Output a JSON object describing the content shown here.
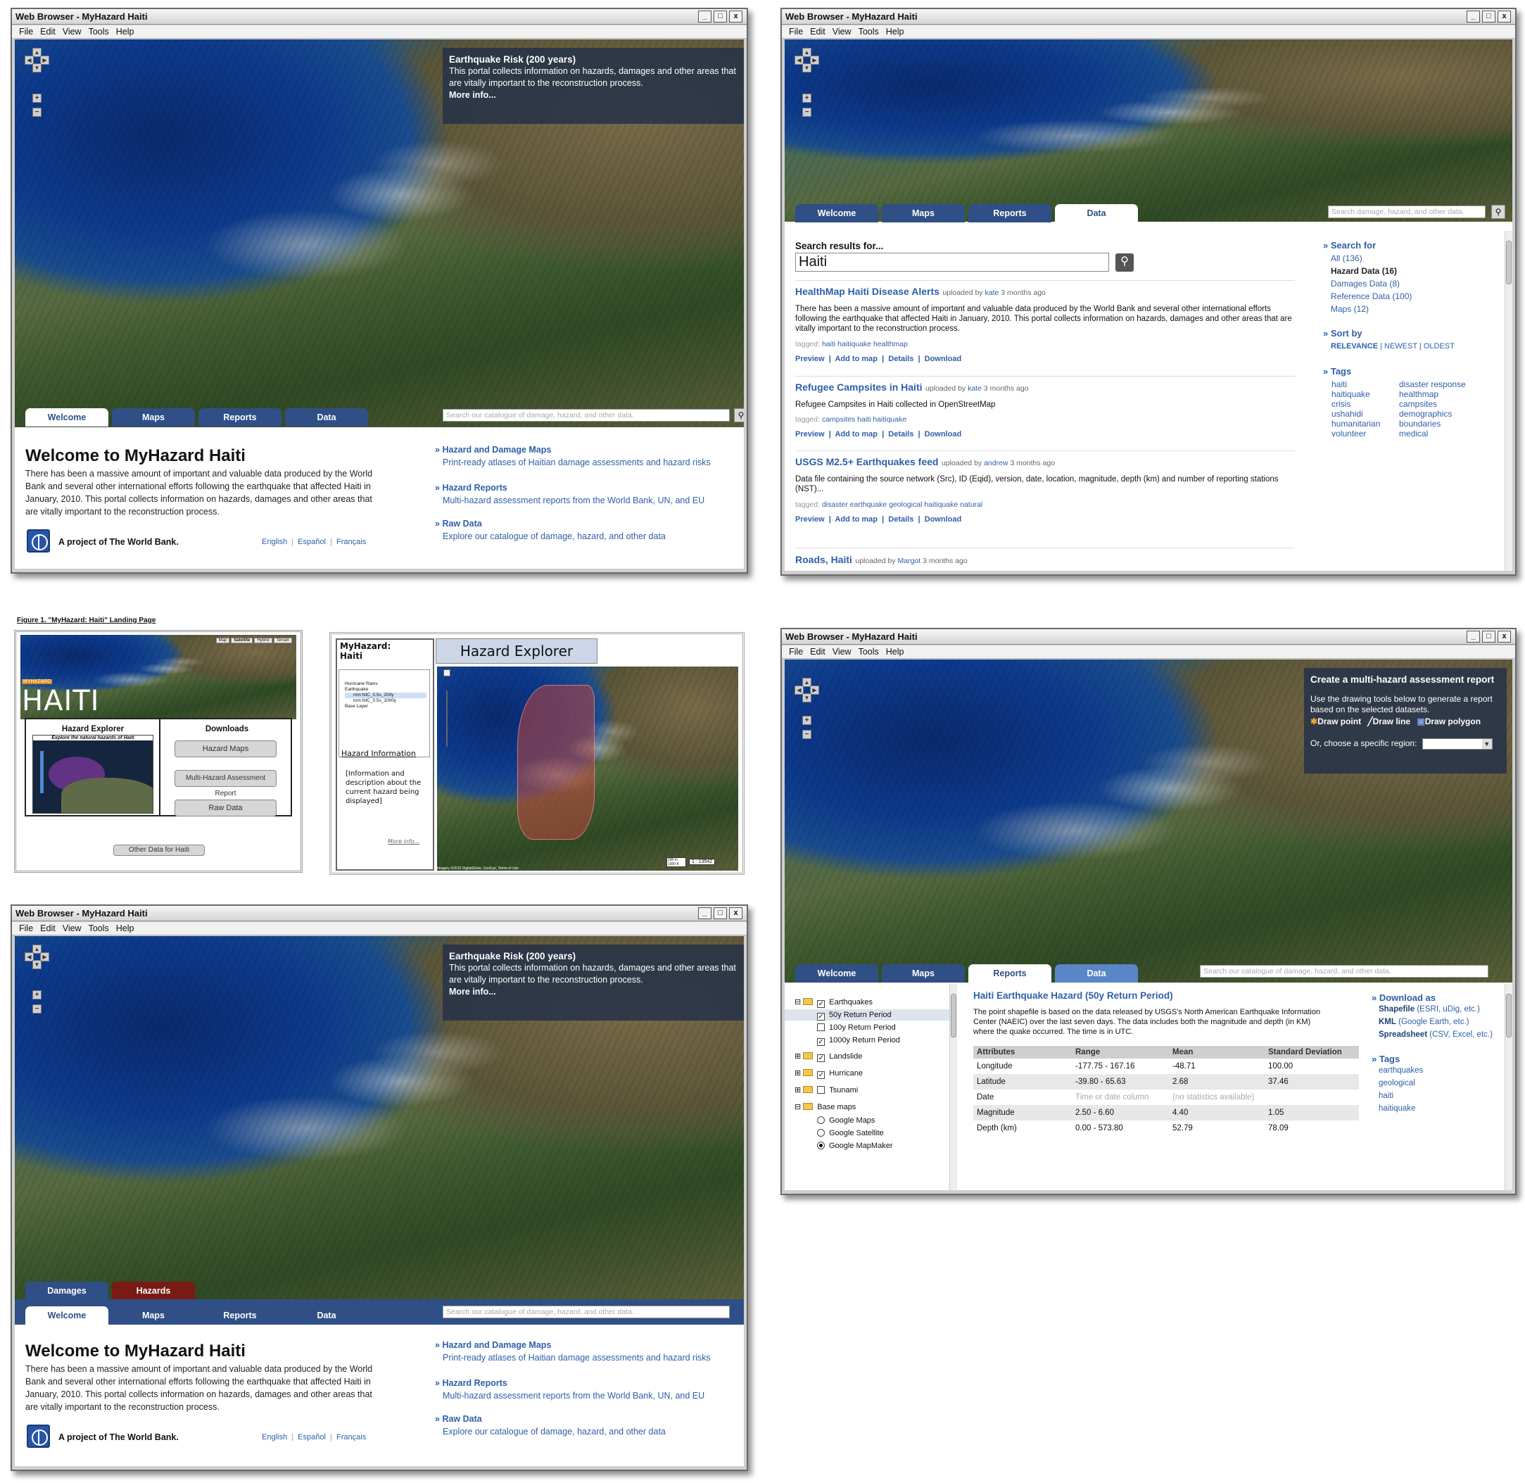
{
  "window": {
    "title": "Web Browser - MyHazard Haiti",
    "menu": [
      "File",
      "Edit",
      "View",
      "Tools",
      "Help"
    ],
    "buttons": {
      "minimize": "_",
      "maximize": "□",
      "close": "x"
    }
  },
  "tabs": {
    "welcome": "Welcome",
    "maps": "Maps",
    "reports": "Reports",
    "data": "Data"
  },
  "search_placeholder": "Search our catalogue of damage, hazard, and other data.",
  "search_placeholder_short": "Search damage, hazard, and other data.",
  "info_panel": {
    "title": "Earthquake Risk (200 years)",
    "body": "This portal collects information on hazards, damages and other areas that are vitally important to the reconstruction process.",
    "more": "More info..."
  },
  "welcome": {
    "heading": "Welcome to MyHazard Haiti",
    "body": "There has been a massive amount of important and valuable data produced by the World Bank and several other international efforts following the earthquake that affected Haiti in January, 2010. This portal collects information on hazards, damages and other areas that are vitally important to the reconstruction process.",
    "project": "A project of The World Bank.",
    "languages": [
      "English",
      "Español",
      "Français"
    ],
    "links": [
      {
        "title": "Hazard and Damage Maps",
        "desc": "Print-ready atlases of Haitian damage assessments and hazard risks"
      },
      {
        "title": "Hazard Reports",
        "desc": "Multi-hazard assessment reports from the World Bank, UN, and EU"
      },
      {
        "title": "Raw Data",
        "desc": "Explore our catalogue of damage, hazard, and other data"
      }
    ]
  },
  "layer_tabs": {
    "damages": "Damages",
    "hazards": "Hazards"
  },
  "data_page": {
    "search_label": "Search results for...",
    "query": "Haiti",
    "results": [
      {
        "title": "HealthMap Haiti Disease Alerts",
        "uploaded": "uploaded by",
        "user": "kate",
        "when": "3 months ago",
        "desc": "There has been a massive amount of important and valuable data produced by the World Bank and several other international efforts following the earthquake that affected Haiti in January, 2010. This portal collects information on hazards, damages and other areas that are vitally important to the reconstruction process.",
        "tagged": "tagged:",
        "tags": "haiti haitiquake healthmap"
      },
      {
        "title": "Refugee Campsites in Haiti",
        "uploaded": "uploaded by",
        "user": "kate",
        "when": "3 months ago",
        "desc": "Refugee Campsites in Haiti collected in OpenStreetMap",
        "tagged": "tagged:",
        "tags": "campsites haiti haitiquake"
      },
      {
        "title": "USGS M2.5+ Earthquakes feed",
        "uploaded": "uploaded by",
        "user": "andrew",
        "when": "3 months ago",
        "desc": "Data file containing the source network (Src), ID (Eqid), version, date, location, magnitude, depth (km) and number of reporting stations (NST)...",
        "tagged": "tagged:",
        "tags": "disaster earthquake geological haitiquake natural"
      },
      {
        "title": "Roads, Haiti",
        "uploaded": "uploaded by",
        "user": "Margot",
        "when": "3 months ago"
      }
    ],
    "actions": "Preview  |  Add to map  |  Details  |  Download",
    "sidebar": {
      "search_for": "» Search for",
      "search_items": [
        "All (136)",
        "Hazard Data (16)",
        "Damages Data (8)",
        "Reference Data (100)",
        "Maps (12)"
      ],
      "sort_by": "» Sort by",
      "sort": {
        "relevance": "RELEVANCE",
        "rest": "| NEWEST | OLDEST"
      },
      "tags_h": "» Tags",
      "tags_col1": [
        "haiti",
        "haitiquake",
        "crisis",
        "ushahidi",
        "humanitarian",
        "volunteer"
      ],
      "tags_col2": [
        "disaster response",
        "healthmap",
        "campsites",
        "demographics",
        "boundaries",
        "medical"
      ]
    }
  },
  "sketches": {
    "figure_caption": "Figure 1. \"MyHazard: Haiti\" Landing Page",
    "haiti_small": "MYHAZARD",
    "haiti_big": "HAITI",
    "hazard_explorer": "Hazard Explorer",
    "explore_natural": "Explore the natural hazards of Haiti",
    "downloads": "Downloads",
    "buttons": [
      "Hazard Maps",
      "Multi-Hazard Assessment Report",
      "Raw Data"
    ],
    "other_data": "Other Data for Haiti",
    "topnav": [
      "Map",
      "Satellite",
      "Hybrid",
      "Terrain"
    ],
    "myhazard_line1": "MyHazard:",
    "myhazard_line2": "Haiti",
    "explorer_title": "Hazard Explorer",
    "layers": [
      "Hurricane Rains",
      "Earthquake",
      "mm:NIC_0.5s_200y",
      "mm:NIC_0.5s_1000y",
      "Base Layer"
    ],
    "hazard_info": "Hazard Information",
    "hazard_info_body": "[Information and description about the current hazard being displayed]",
    "more_info": "More info...",
    "scale": "1 : 13542",
    "scale_unit": "200 m 1000 ft",
    "imagery_credit": "Imagery ©2010 DigitalGlobe, GeoEye, Terms of Use"
  },
  "reports_page": {
    "panel_title": "Create a multi-hazard assessment report",
    "panel_body": "Use the drawing tools below to generate a report based on the selected datasets.",
    "tools": [
      "Draw point",
      "Draw line",
      "Draw polygon"
    ],
    "region_label": "Or, choose a specific region:",
    "tree": [
      {
        "label": "Earthquakes",
        "checked": true
      },
      {
        "label": "50y Return Period",
        "checked": true
      },
      {
        "label": "100y Return Period",
        "checked": false
      },
      {
        "label": "1000y Return Period",
        "checked": true
      },
      {
        "label": "Landslide",
        "checked": true
      },
      {
        "label": "Hurricane",
        "checked": true
      },
      {
        "label": "Tsunami",
        "checked": false
      },
      {
        "label": "Base maps"
      },
      {
        "label": "Google Maps"
      },
      {
        "label": "Google Satellite"
      },
      {
        "label": "Google MapMaker"
      }
    ],
    "dataset_title": "Haiti Earthquake Hazard (50y Return Period)",
    "dataset_desc": "The point shapefile is based on the data released by USGS's North American Earthquake Information Center (NAEIC) over the last seven days. The data includes both the magnitude and depth (in KM) where the quake occurred. The time is in UTC.",
    "table_headers": [
      "Attributes",
      "Range",
      "Mean",
      "Standard Deviation"
    ],
    "table_rows": [
      [
        "Longitude",
        "-177.75 - 167.16",
        "-48.71",
        "100.00"
      ],
      [
        "Latitude",
        "-39.80 - 65.63",
        "2.68",
        "37.46"
      ],
      [
        "Date",
        "Time or date column",
        "(no statistics available)",
        ""
      ],
      [
        "Magnitude",
        "2.50 - 6.60",
        "4.40",
        "1.05"
      ],
      [
        "Depth (km)",
        "0.00 - 573.80",
        "52.79",
        "78.09"
      ]
    ],
    "download_h": "» Download as",
    "downloads": [
      {
        "name": "Shapefile",
        "detail": "(ESRI, uDig, etc.)"
      },
      {
        "name": "KML",
        "detail": "(Google Earth, etc.)"
      },
      {
        "name": "Spreadsheet",
        "detail": "(CSV, Excel, etc.)"
      }
    ],
    "tags_h": "» Tags",
    "tags": [
      "earthquakes",
      "geological",
      "haiti",
      "haitiquake"
    ]
  },
  "colors": {
    "brand": "#2f4f86",
    "link": "#2e5fa8",
    "hazards_tab": "#7a1a14",
    "panel": "#223048"
  }
}
